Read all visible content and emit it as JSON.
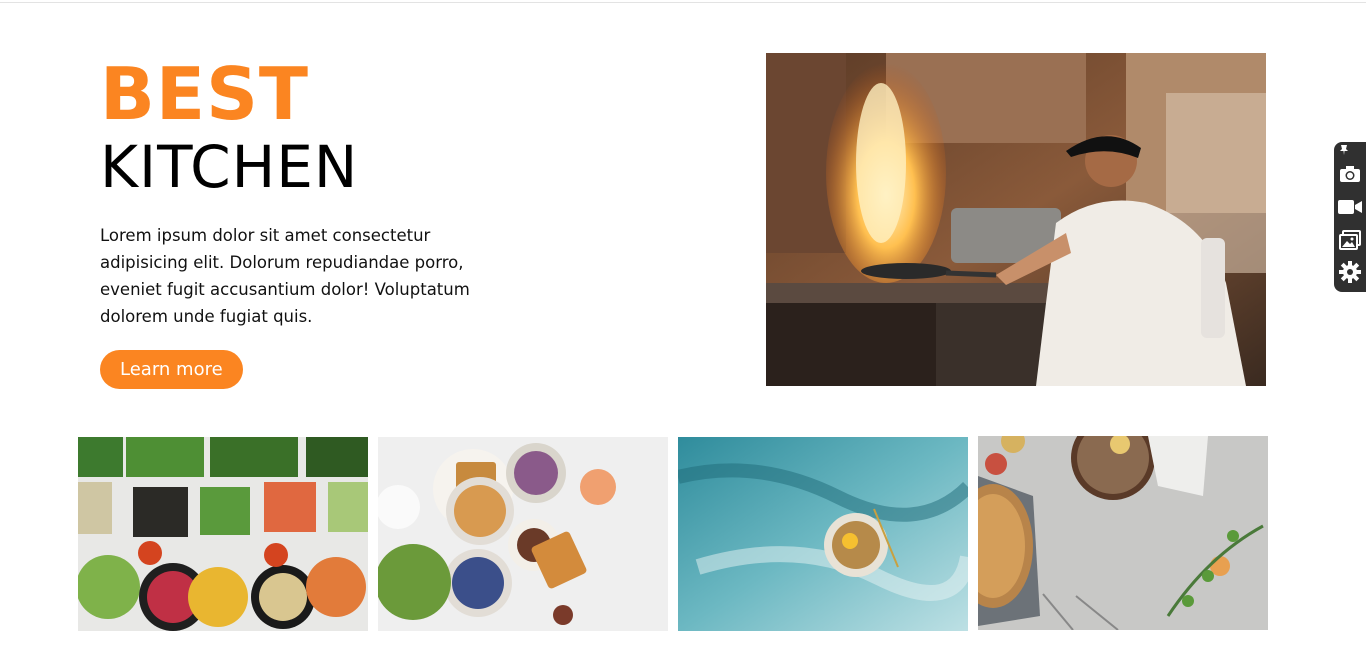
{
  "hero": {
    "title_line1": "BEST",
    "title_line2": "KITCHEN",
    "description": "Lorem ipsum dolor sit amet consectetur adipisicing elit. Dolorum repudiandae porro, eveniet fugit accusantium dolor! Voluptatum dolorem unde fugiat quis.",
    "button_label": "Learn more"
  },
  "colors": {
    "accent": "#fb8521",
    "sidebar": "#303030"
  },
  "sidebar": {
    "icons": [
      "pin-icon",
      "camera-icon",
      "video-camera-icon",
      "image-gallery-icon",
      "gear-icon"
    ]
  },
  "gallery": {
    "tiles": [
      "salad-bar-photo",
      "breakfast-table-photo",
      "plated-dish-photo",
      "pie-table-photo"
    ]
  }
}
